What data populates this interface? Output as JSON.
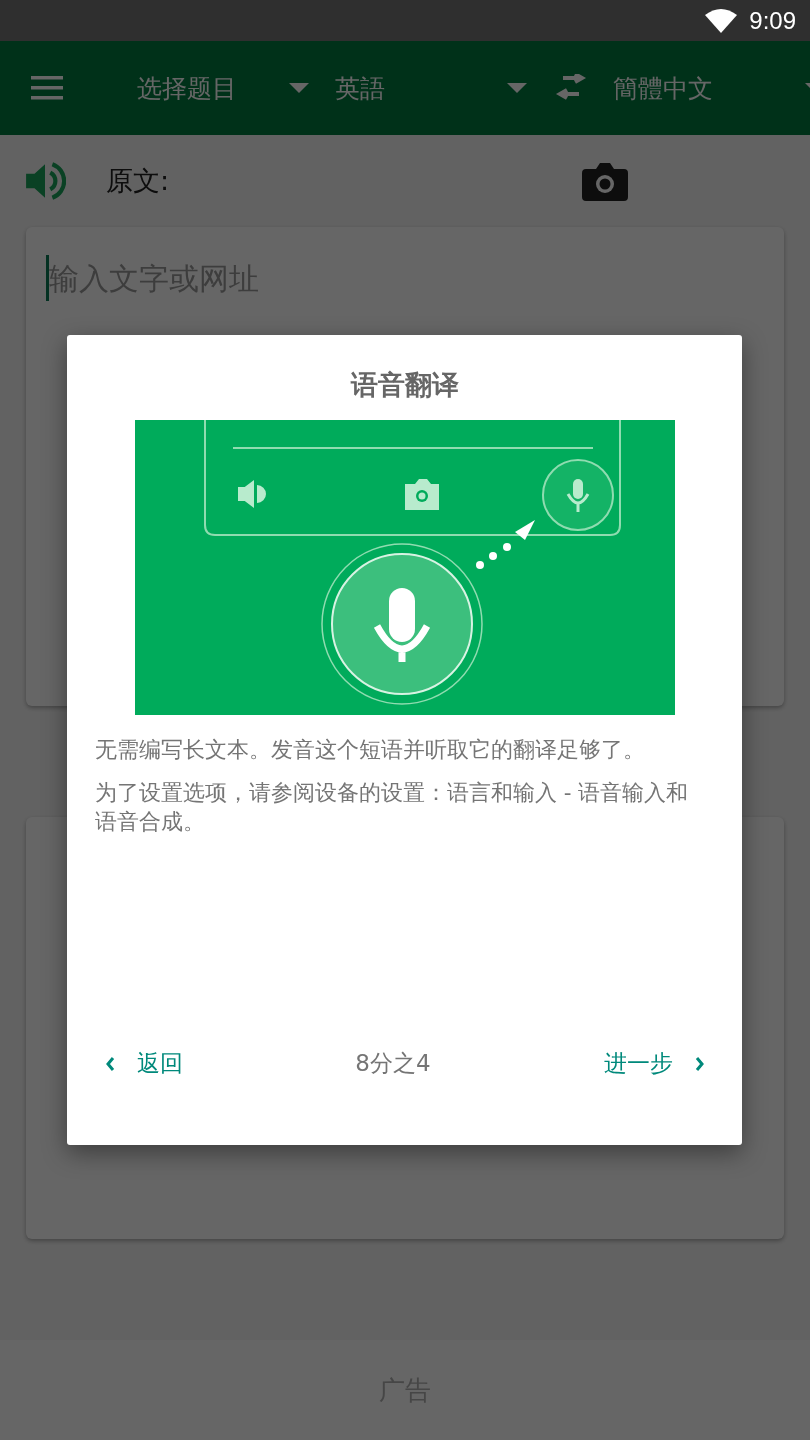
{
  "status_bar": {
    "time": "9:09"
  },
  "toolbar": {
    "topic": "选择题目",
    "source_language": "英語",
    "target_language": "簡體中文"
  },
  "source": {
    "label": "原文:",
    "placeholder": "输入文字或网址"
  },
  "ad": {
    "label": "广告"
  },
  "dialog": {
    "title": "语音翻译",
    "paragraphs": [
      "无需编写长文本。发音这个短语并听取它的翻译足够了。",
      "为了设置选项，请参阅设备的设置：语言和输入 - 语音输入和语音合成。"
    ],
    "back": "返回",
    "page": "8分之4",
    "next": "进一步"
  }
}
